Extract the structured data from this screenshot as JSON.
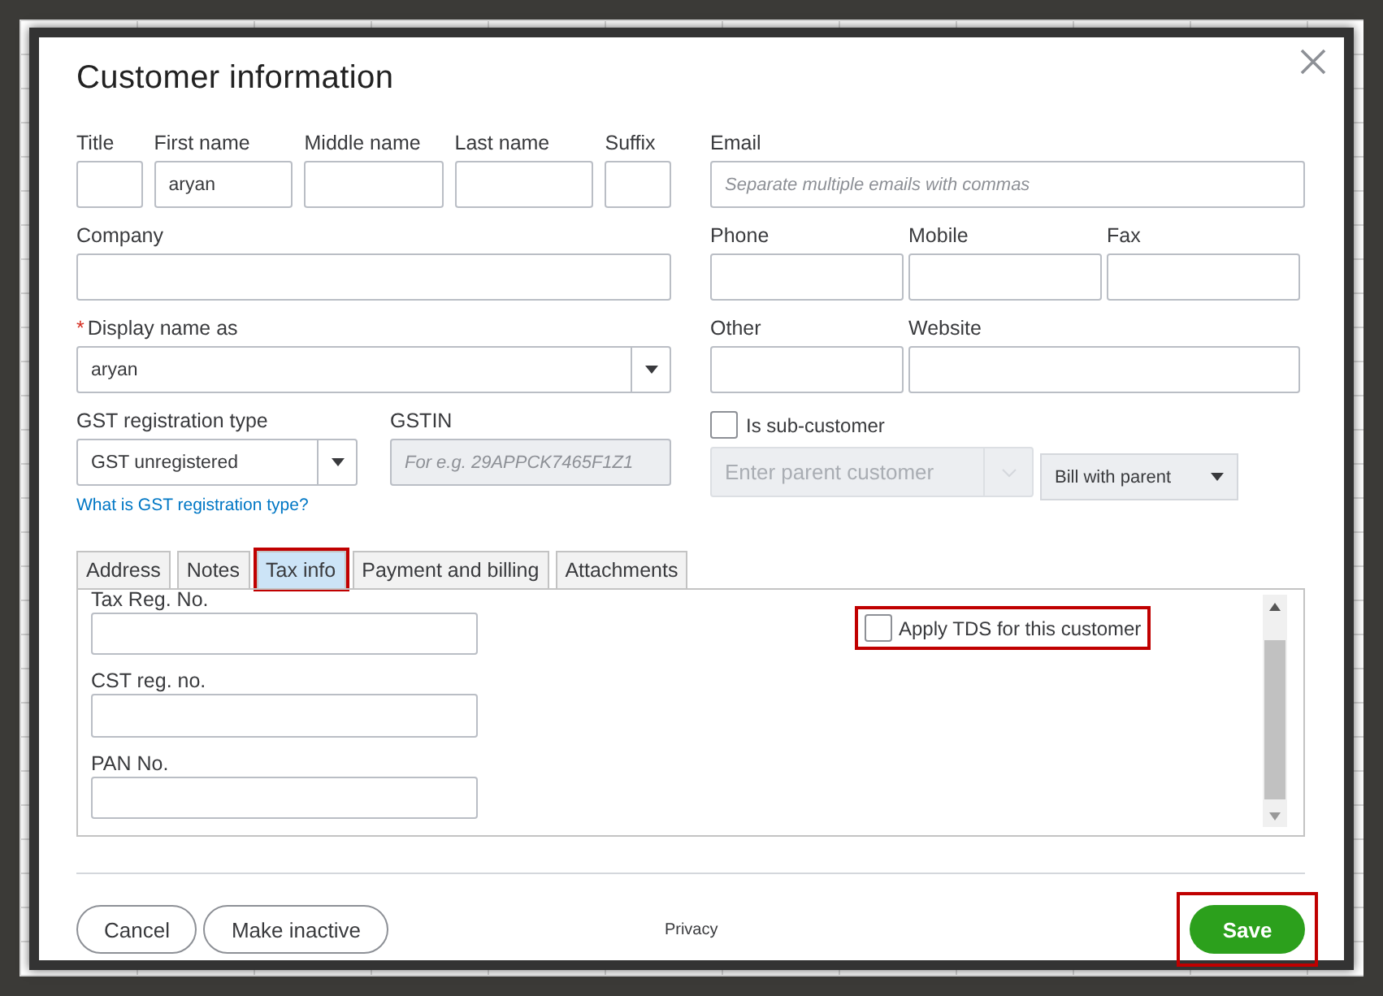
{
  "dialog": {
    "title": "Customer information"
  },
  "name_fields": [
    {
      "label": "Title"
    },
    {
      "label": "First name",
      "value": "aryan"
    },
    {
      "label": "Middle name"
    },
    {
      "label": "Last name"
    },
    {
      "label": "Suffix"
    }
  ],
  "company": {
    "label": "Company"
  },
  "display_name": {
    "label": "Display name as",
    "required": true,
    "required_mark": "*",
    "value": "aryan"
  },
  "gst_type": {
    "label": "GST registration type",
    "value": "GST unregistered"
  },
  "gstin": {
    "label": "GSTIN",
    "placeholder": "For e.g. 29APPCK7465F1Z1",
    "disabled": true
  },
  "gst_help_link": "What is GST registration type?",
  "email": {
    "label": "Email",
    "placeholder": "Separate multiple emails with commas"
  },
  "contact_fields": [
    {
      "label": "Phone"
    },
    {
      "label": "Mobile"
    },
    {
      "label": "Fax"
    }
  ],
  "other": {
    "label": "Other"
  },
  "website": {
    "label": "Website"
  },
  "sub_customer": {
    "label": "Is sub-customer",
    "checked": false
  },
  "parent_customer": {
    "placeholder": "Enter parent customer",
    "disabled": true
  },
  "bill_option": {
    "value": "Bill with parent"
  },
  "tabs": [
    {
      "label": "Address",
      "selected": false,
      "highlighted": false
    },
    {
      "label": "Notes",
      "selected": false,
      "highlighted": false
    },
    {
      "label": "Tax info",
      "selected": true,
      "highlighted": true
    },
    {
      "label": "Payment and billing",
      "selected": false,
      "highlighted": false
    },
    {
      "label": "Attachments",
      "selected": false,
      "highlighted": false
    }
  ],
  "tax_fields": [
    {
      "label": "Tax Reg. No."
    },
    {
      "label": "CST reg. no."
    },
    {
      "label": "PAN No."
    }
  ],
  "apply_tds": {
    "label": "Apply TDS for this customer",
    "checked": false,
    "highlighted": true
  },
  "footer": {
    "buttons": [
      {
        "label": "Cancel"
      },
      {
        "label": "Make inactive"
      }
    ],
    "privacy": "Privacy",
    "save": {
      "label": "Save",
      "highlighted": true
    }
  }
}
